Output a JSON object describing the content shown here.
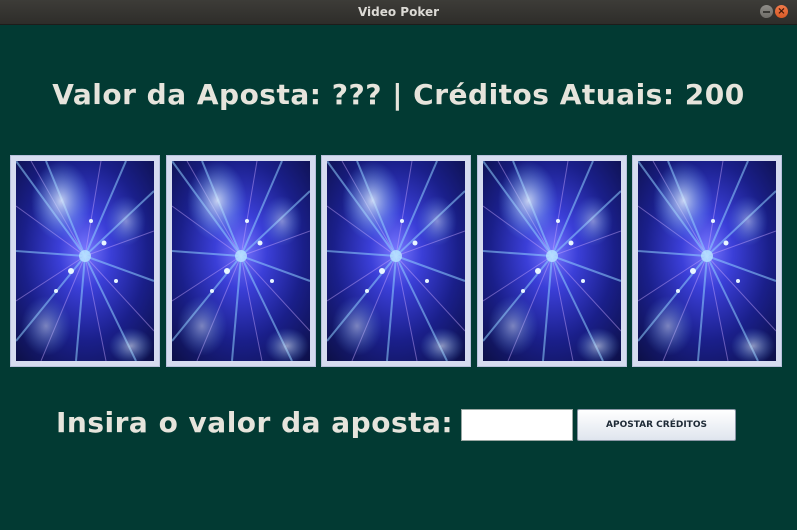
{
  "window": {
    "title": "Video Poker"
  },
  "header": {
    "bet_label": "Valor da Aposta:",
    "bet_value": "???",
    "separator": "|",
    "credits_label": "Créditos Atuais:",
    "credits_value": "200"
  },
  "cards": [
    {
      "state": "face-down",
      "back": "blue-galaxy"
    },
    {
      "state": "face-down",
      "back": "blue-galaxy"
    },
    {
      "state": "face-down",
      "back": "blue-galaxy"
    },
    {
      "state": "face-down",
      "back": "blue-galaxy"
    },
    {
      "state": "face-down",
      "back": "blue-galaxy"
    }
  ],
  "bet_form": {
    "label": "Insira o valor da aposta:",
    "input_value": "",
    "button_label": "APOSTAR CRÉDITOS"
  },
  "colors": {
    "background": "#023a33",
    "text": "#e6e4dc",
    "card_border": "#d6dcf0"
  }
}
